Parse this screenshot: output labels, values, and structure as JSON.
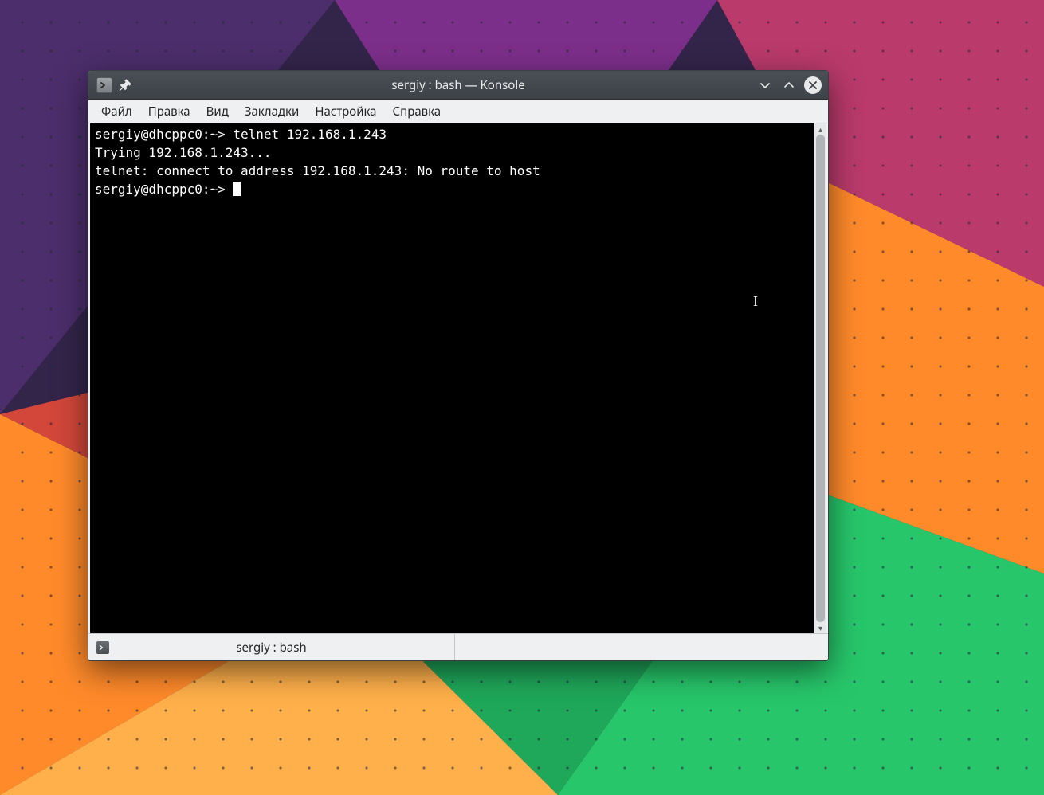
{
  "window": {
    "title": "sergiy : bash — Konsole"
  },
  "menubar": {
    "items": [
      "Файл",
      "Правка",
      "Вид",
      "Закладки",
      "Настройка",
      "Справка"
    ]
  },
  "terminal": {
    "lines": [
      {
        "prompt": "sergiy@dhcppc0:~> ",
        "cmd": "telnet 192.168.1.243"
      },
      {
        "text": "Trying 192.168.1.243..."
      },
      {
        "text": "telnet: connect to address 192.168.1.243: No route to host"
      },
      {
        "prompt": "sergiy@dhcppc0:~> ",
        "cursor": true
      }
    ]
  },
  "tab": {
    "label": "sergiy : bash"
  }
}
